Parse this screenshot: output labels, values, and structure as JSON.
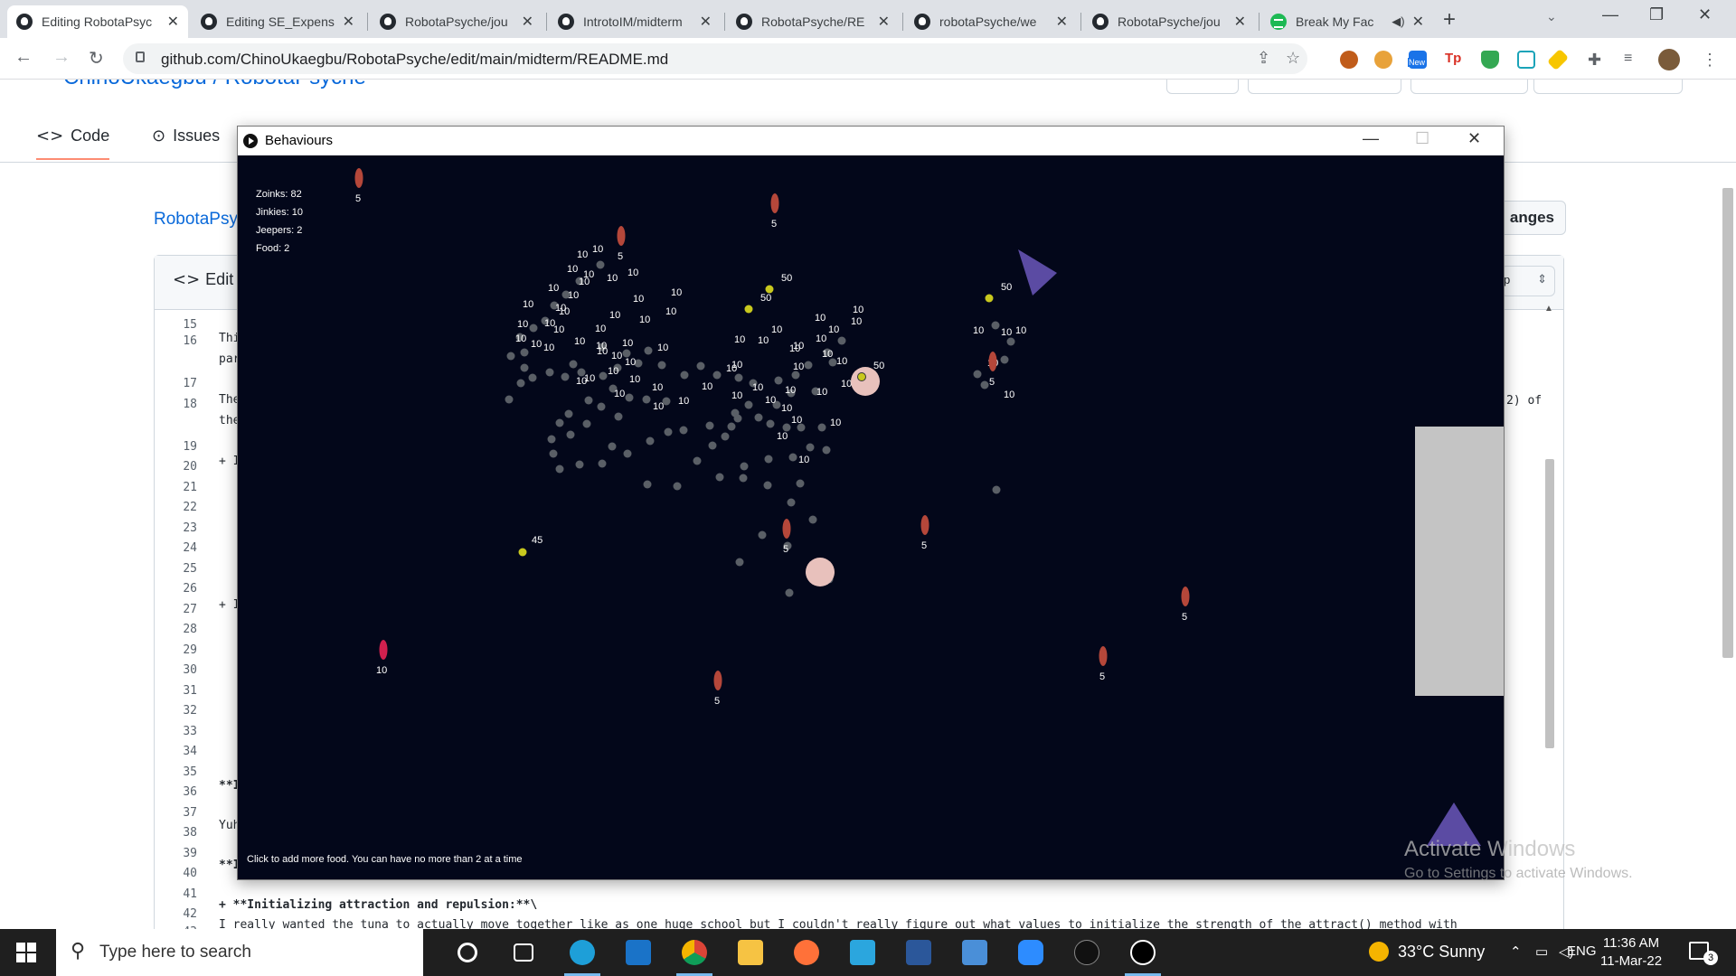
{
  "browser": {
    "tabs": [
      {
        "title": "Editing RobotaPsyc",
        "icon": "github-icon",
        "active": true
      },
      {
        "title": "Editing SE_Expens",
        "icon": "github-icon"
      },
      {
        "title": "RobotaPsyche/jou",
        "icon": "github-icon"
      },
      {
        "title": "IntrotoIM/midterm",
        "icon": "github-icon"
      },
      {
        "title": "RobotaPsyche/RE",
        "icon": "github-icon"
      },
      {
        "title": "robotaPsyche/we",
        "icon": "github-icon"
      },
      {
        "title": "RobotaPsyche/jou",
        "icon": "github-icon"
      },
      {
        "title": "Break My Fac",
        "icon": "spotify-icon"
      }
    ],
    "url": "github.com/ChinoUkaegbu/RobotaPsyche/edit/main/midterm/README.md",
    "extension_badge": "New"
  },
  "github": {
    "repo_header": "ChinoUkaegbu / RobotaPsyche",
    "tabs": [
      {
        "label": "Code",
        "glyph": "<>"
      },
      {
        "label": "Issues",
        "glyph": "⊙"
      }
    ],
    "breadcrumb": "RobotaPsy",
    "edit_label": "Edit f",
    "changes_button": "anges",
    "wrap_select": "p",
    "line_numbers": [
      "15",
      "16",
      "17",
      "18",
      "19",
      "20",
      "21",
      "22",
      "23",
      "24",
      "25",
      "26",
      "27",
      "28",
      "29",
      "30",
      "31",
      "32",
      "33",
      "34",
      "35",
      "36",
      "37",
      "38",
      "39",
      "40",
      "41",
      "42",
      "43"
    ],
    "code_lines": [
      {
        "text": "Thi"
      },
      {
        "text": "par"
      },
      {
        "text": "The"
      },
      {
        "text": "the"
      },
      {
        "text": "+ I"
      },
      {
        "text": "+ I"
      },
      {
        "text": "**I"
      },
      {
        "text": "Yuh"
      },
      {
        "text": "**I"
      },
      {
        "text": "+ **Initializing attraction and repulsion:**\\"
      },
      {
        "text": "I really wanted the tuna to actually move together like as one huge school but I couldn't really figure out what values to initialize the strength of the attract() method with"
      }
    ],
    "code_right_fragment": "2) of"
  },
  "behaviours_window": {
    "title": "Behaviours",
    "hud": {
      "zoinks": "Zoinks: 82",
      "jinkies": "Jinkies: 10",
      "jeepers": "Jeepers: 2",
      "food": "Food: 2"
    },
    "hint": "Click to add more food. You can have no more than 2 at a time",
    "colors": {
      "background": "#03071a",
      "zoink": "#5a5f66",
      "jinkie": "#b5473a",
      "jinkie_magenta": "#d0204e",
      "jeeper": "#5b4ba3",
      "yellow": "#c8c81e",
      "food": "#e8c1bc",
      "panel": "#c4c4c4"
    },
    "zoink_labels": [
      "10"
    ],
    "jinkie_labels": [
      "5",
      "10"
    ],
    "yellow_labels": [
      "50",
      "45"
    ]
  },
  "watermark": {
    "title": "Activate Windows",
    "subtitle": "Go to Settings to activate Windows."
  },
  "taskbar": {
    "search_placeholder": "Type here to search",
    "weather": "33°C  Sunny",
    "language": "ENG",
    "time": "11:36 AM",
    "date": "11-Mar-22",
    "notification_count": "3"
  }
}
